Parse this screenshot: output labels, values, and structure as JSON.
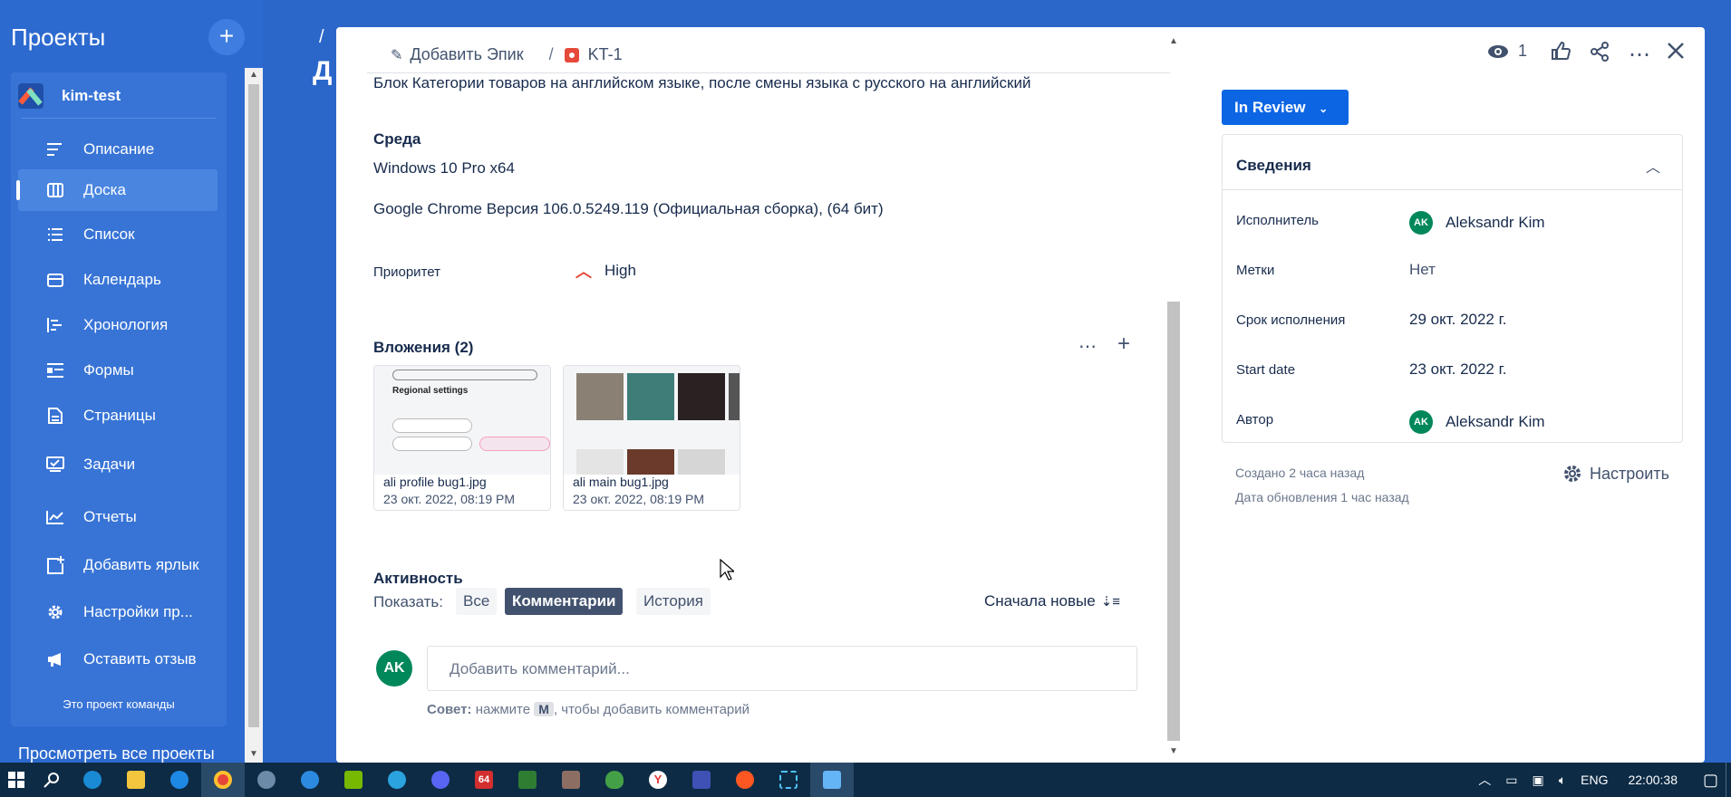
{
  "sidebar": {
    "title": "Проекты",
    "add_label": "+",
    "project_name": "kim-test",
    "items": [
      {
        "label": "Описание"
      },
      {
        "label": "Доска"
      },
      {
        "label": "Список"
      },
      {
        "label": "Календарь"
      },
      {
        "label": "Хронология"
      },
      {
        "label": "Формы"
      },
      {
        "label": "Страницы"
      },
      {
        "label": "Задачи"
      },
      {
        "label": "Отчеты"
      },
      {
        "label": "Добавить ярлык"
      },
      {
        "label": "Настройки пр..."
      },
      {
        "label": "Оставить отзыв"
      }
    ],
    "active_index": 1,
    "footer_text": "Это проект команды",
    "view_all": "Просмотреть все проекты"
  },
  "background": {
    "crumb": "/",
    "title_fragment": "Д"
  },
  "issue": {
    "add_epic": "Добавить Эпик",
    "crumb_sep": "/",
    "key": "KT-1",
    "desc_text": "Блок Категории товаров на английском языке, после смены языка с русского на английский",
    "env_label": "Среда",
    "env_line1": "Windows 10 Pro x64",
    "env_line2": "Google Chrome Версия 106.0.5249.119 (Официальная сборка), (64 бит)",
    "priority_label": "Приоритет",
    "priority_value": "High",
    "attachments_label": "Вложения (2)",
    "attachments": [
      {
        "name": "ali profile bug1.jpg",
        "date": "23 окт. 2022, 08:19 PM",
        "thumb_heading": "Regional settings"
      },
      {
        "name": "ali main bug1.jpg",
        "date": "23 окт. 2022, 08:19 PM"
      }
    ],
    "activity_label": "Активность",
    "show_label": "Показать:",
    "filters": [
      "Все",
      "Комментарии",
      "История"
    ],
    "active_filter": 1,
    "sort_label": "Сначала новые",
    "comment_avatar": "AK",
    "comment_placeholder": "Добавить комментарий...",
    "tip_bold": "Совет:",
    "tip_before": "нажмите",
    "tip_key": "M",
    "tip_after": ", чтобы добавить комментарий"
  },
  "actions": {
    "watch_count": "1"
  },
  "status": {
    "label": "In Review"
  },
  "details": {
    "title": "Сведения",
    "rows": [
      {
        "key": "Исполнитель",
        "value": "Aleksandr Kim",
        "avatar": "AK"
      },
      {
        "key": "Метки",
        "value": "Нет"
      },
      {
        "key": "Срок исполнения",
        "value": "29 окт. 2022 г."
      },
      {
        "key": "Start date",
        "value": "23 окт. 2022 г."
      },
      {
        "key": "Автор",
        "value": "Aleksandr Kim",
        "avatar": "AK"
      }
    ],
    "created": "Создано 2 часа назад",
    "updated": "Дата обновления 1 час назад",
    "configure": "Настроить"
  },
  "taskbar": {
    "lang": "ENG",
    "time": "22:00:38",
    "app_64_label": "64"
  },
  "colors": {
    "accent": "#0c66e4",
    "sidebar_bg": "#2d6ad0",
    "avatar": "#00875a",
    "priority_high": "#e5493a"
  }
}
